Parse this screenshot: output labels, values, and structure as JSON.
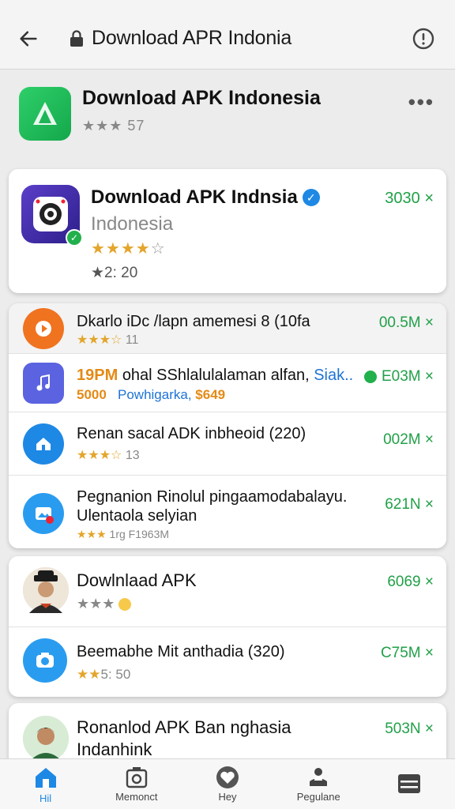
{
  "browser": {
    "url_text": "Download APR Indonia"
  },
  "header_app": {
    "title": "Download APK Indonesia",
    "rating_text": "★★★ 57"
  },
  "featured": {
    "title": "Download APK Indnsia",
    "subtitle": "Indonesia",
    "stars": "★★★★",
    "stars_tail": "☆",
    "count": "★2: 20",
    "size": "3030 ×"
  },
  "list1": [
    {
      "title": "Dkarlo iDc /lapn amemesi 8 (10fa",
      "sub": "11",
      "stars": "★★★☆",
      "size": "00.5M ×"
    },
    {
      "title_a": "19PM",
      "title_b": "ohal SShlalulalaman alfan,",
      "title_c": "Siak..",
      "sub_a": "5000",
      "sub_b": "Powhigarka,",
      "sub_c": "$649",
      "size": "E03M ×"
    },
    {
      "title": "Renan sacal ADK inbheoid (220)",
      "sub": "13",
      "stars": "★★★☆",
      "size": "002M ×"
    },
    {
      "title": "Pegnanion Rinolul pingaamodabalayu.",
      "title2": "Ulentaola selyian",
      "sub": "1rg F1963M",
      "stars": "★★★",
      "size": "621N ×"
    }
  ],
  "list2": [
    {
      "title": "Dowlnlaad APK",
      "stars": "★★★",
      "size": "6069 ×"
    },
    {
      "title": "Beemabhe Mit anthadia (320)",
      "sub": "5: 50",
      "stars": "★★",
      "size": "C75M ×"
    }
  ],
  "list3": [
    {
      "title": "Ronanlod APK Ban nghasia",
      "title2": "Indanhink",
      "size": "503N ×"
    }
  ],
  "nav": [
    {
      "label": "Hil"
    },
    {
      "label": "Memonct"
    },
    {
      "label": "Hey"
    },
    {
      "label": "Pegulane"
    },
    {
      "label": ""
    }
  ],
  "colors": {
    "accent_green": "#21a048",
    "star": "#e3a52b",
    "active_blue": "#1e88e5"
  }
}
